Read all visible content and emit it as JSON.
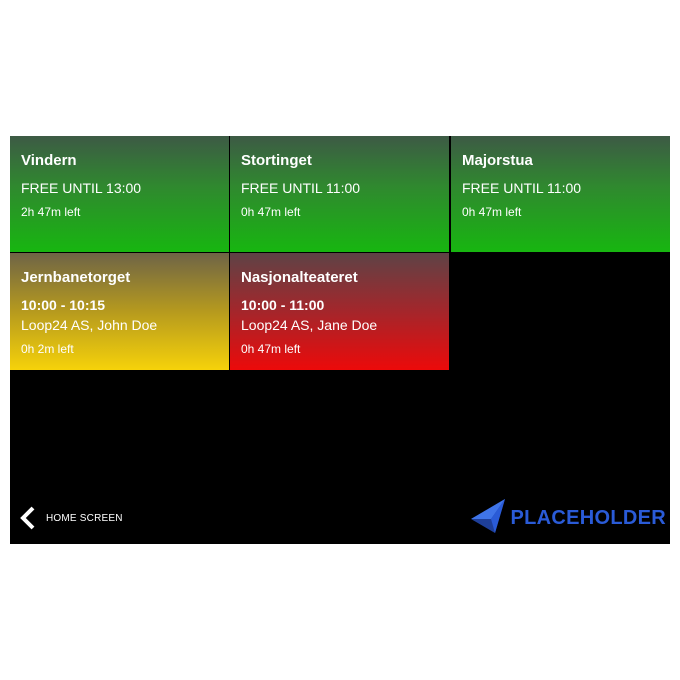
{
  "rooms": [
    {
      "name": "Vindern",
      "status": "free",
      "line1": "FREE UNTIL 13:00",
      "line2": "",
      "time_left": "2h 47m left"
    },
    {
      "name": "Stortinget",
      "status": "free",
      "line1": "FREE UNTIL 11:00",
      "line2": "",
      "time_left": "0h 47m left"
    },
    {
      "name": "Majorstua",
      "status": "free",
      "line1": "FREE UNTIL 11:00",
      "line2": "",
      "time_left": "0h 47m left"
    },
    {
      "name": "Jernbanetorget",
      "status": "ending-soon",
      "line1": "10:00 - 10:15",
      "line2": "Loop24 AS, John Doe",
      "time_left": "0h 2m left"
    },
    {
      "name": "Nasjonalteateret",
      "status": "occupied",
      "line1": "10:00 - 11:00",
      "line2": "Loop24 AS, Jane Doe",
      "time_left": "0h 47m left"
    }
  ],
  "nav": {
    "home_label": "HOME SCREEN",
    "back_icon": "chevron-left-icon"
  },
  "logo": {
    "text": "PLACEHOLDER",
    "color": "#2a5bd7"
  },
  "colors": {
    "free": "#17b610",
    "ending_soon": "#f6d20a",
    "occupied": "#ec0a0a",
    "background": "#000000"
  }
}
